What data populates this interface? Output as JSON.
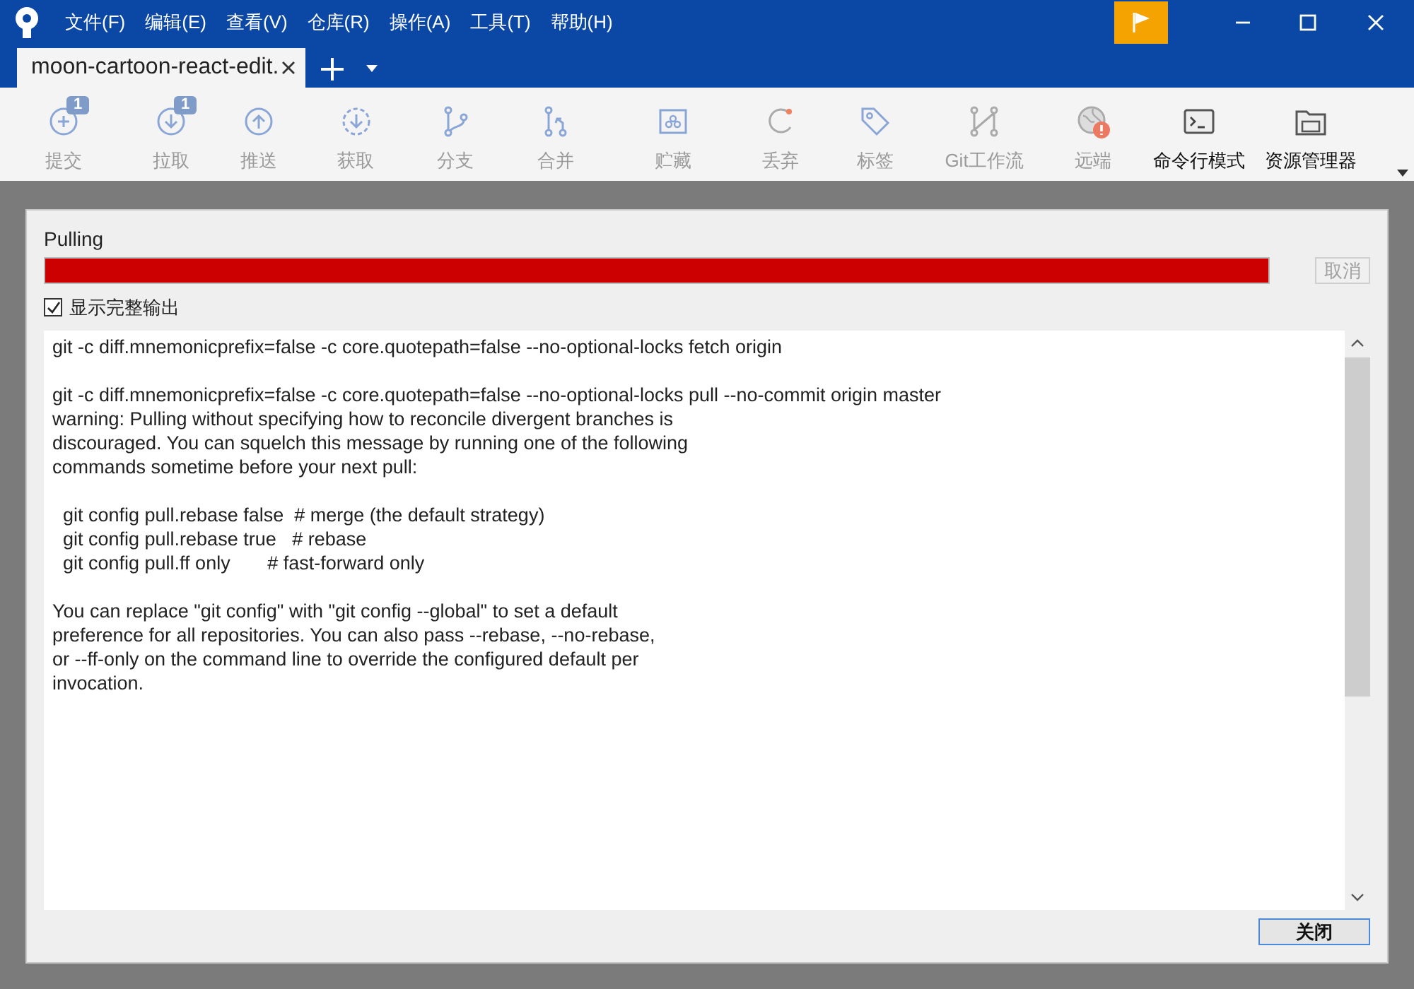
{
  "menu": [
    "文件(F)",
    "编辑(E)",
    "查看(V)",
    "仓库(R)",
    "操作(A)",
    "工具(T)",
    "帮助(H)"
  ],
  "tabs": [
    {
      "label": "moon-cartoon-react-edit.",
      "selected": true
    }
  ],
  "toolbar": [
    {
      "label": "提交",
      "kind": "commit",
      "badge": "1",
      "disabled": true
    },
    {
      "label": "拉取",
      "kind": "pull",
      "badge": "1",
      "disabled": true
    },
    {
      "label": "推送",
      "kind": "push",
      "disabled": true
    },
    {
      "label": "获取",
      "kind": "fetch",
      "disabled": true
    },
    {
      "label": "分支",
      "kind": "branch",
      "disabled": true
    },
    {
      "label": "合并",
      "kind": "merge",
      "disabled": true
    },
    {
      "label": "贮藏",
      "kind": "stash",
      "disabled": true
    },
    {
      "label": "丢弃",
      "kind": "discard",
      "disabled": true
    },
    {
      "label": "标签",
      "kind": "tag",
      "disabled": true
    },
    {
      "label": "Git工作流",
      "kind": "flow",
      "disabled": true
    },
    {
      "label": "远端",
      "kind": "remote",
      "disabled": true
    },
    {
      "label": "命令行模式",
      "kind": "terminal",
      "disabled": false
    },
    {
      "label": "资源管理器",
      "kind": "explorer",
      "disabled": false
    }
  ],
  "dialog": {
    "title": "Pulling",
    "progress": {
      "level": 1,
      "failed": true
    },
    "cancel_button": {
      "label": "取消",
      "disabled": true
    },
    "show_full_output": {
      "label": "显示完整输出",
      "checked": true
    },
    "output": [
      [
        "git -c diff.mnemonicprefix=false -c core.quotepath=false --no-optional-locks fetch origin"
      ],
      [
        "git -c diff.mnemonicprefix=false -c core.quotepath=false --no-optional-locks pull --no-commit origin master",
        "warning: Pulling without specifying how to reconcile divergent branches is",
        "discouraged. You can squelch this message by running one of the following",
        "commands sometime before your next pull:"
      ],
      [
        "  git config pull.rebase false  # merge (the default strategy)",
        "  git config pull.rebase true   # rebase",
        "  git config pull.ff only       # fast-forward only"
      ],
      [
        "You can replace \"git config\" with \"git config --global\" to set a default",
        "preference for all repositories. You can also pass --rebase, --no-rebase,",
        "or --ff-only on the command line to override the configured default per",
        "invocation."
      ]
    ],
    "close_button": "关闭"
  }
}
